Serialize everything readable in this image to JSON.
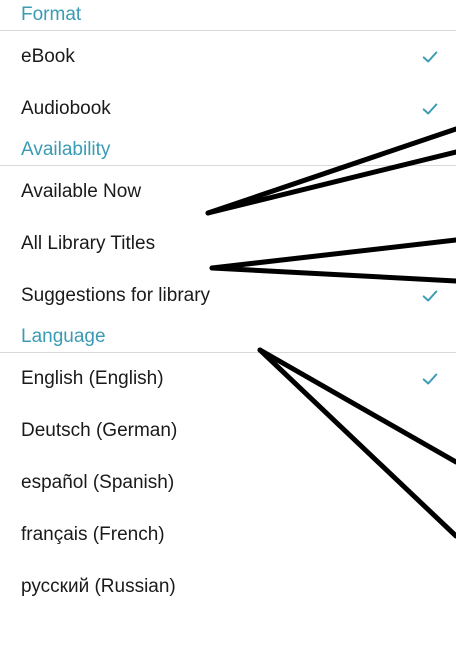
{
  "colors": {
    "accent": "#3a9bb4",
    "text": "#1a1a1a",
    "divider": "#d9d9d9",
    "annotation": "#000000"
  },
  "sections": {
    "format": {
      "title": "Format",
      "items": [
        {
          "label": "eBook",
          "checked": true
        },
        {
          "label": "Audiobook",
          "checked": true
        }
      ]
    },
    "availability": {
      "title": "Availability",
      "items": [
        {
          "label": "Available Now",
          "checked": false
        },
        {
          "label": "All Library Titles",
          "checked": false
        },
        {
          "label": "Suggestions for library",
          "checked": true
        }
      ]
    },
    "language": {
      "title": "Language",
      "items": [
        {
          "label": "English (English)",
          "checked": true
        },
        {
          "label": "Deutsch (German)",
          "checked": false
        },
        {
          "label": "español (Spanish)",
          "checked": false
        },
        {
          "label": "français (French)",
          "checked": false
        },
        {
          "label": "русский (Russian)",
          "checked": false
        }
      ]
    }
  },
  "icons": {
    "check": "checkmark-icon"
  }
}
